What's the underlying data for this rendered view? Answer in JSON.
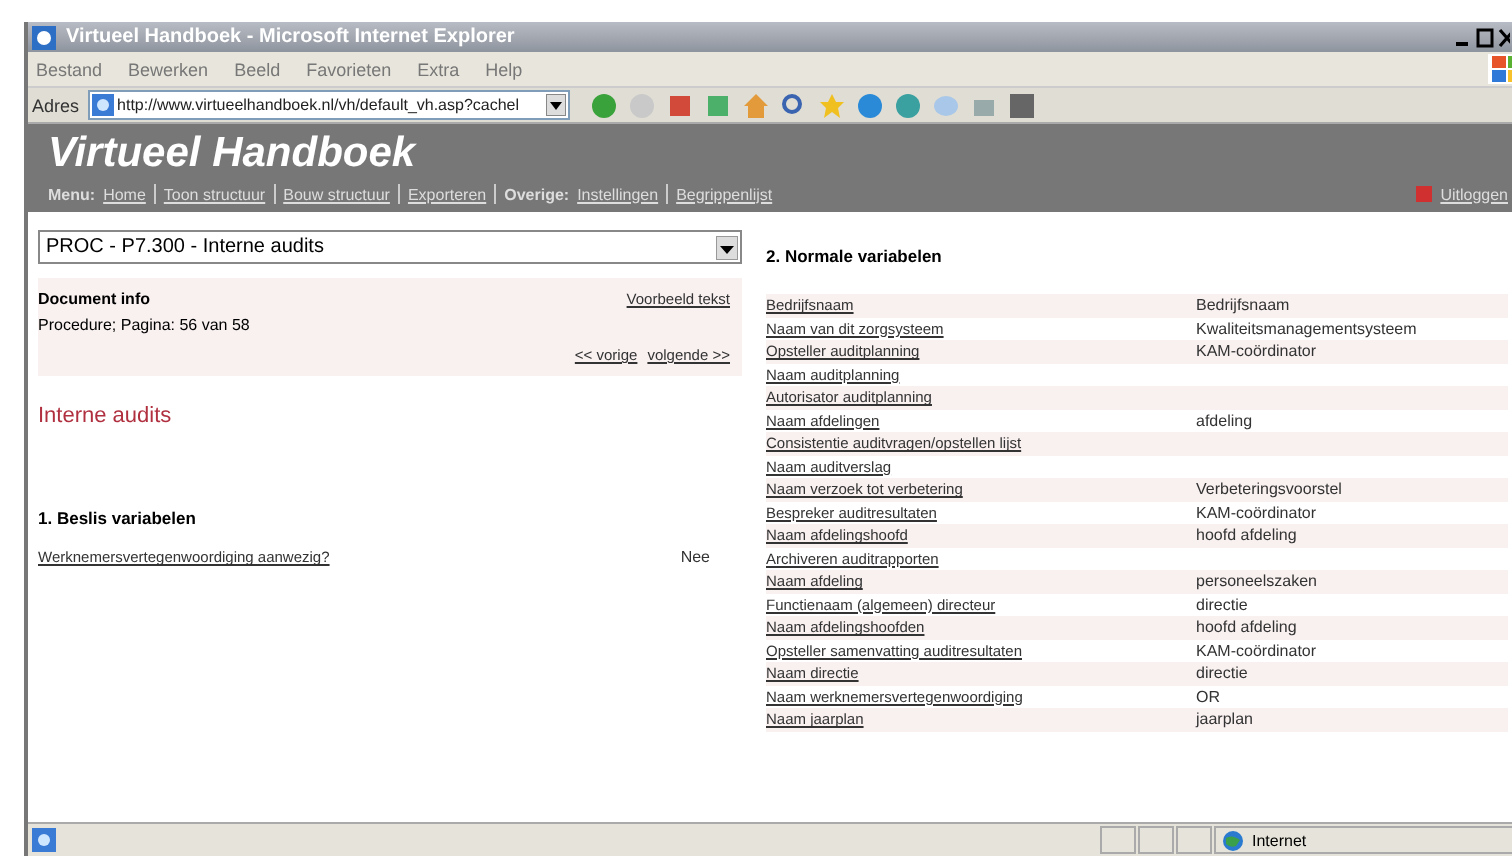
{
  "window": {
    "title": "Virtueel Handboek - Microsoft Internet Explorer"
  },
  "menu_bar": [
    "Bestand",
    "Bewerken",
    "Beeld",
    "Favorieten",
    "Extra",
    "Help"
  ],
  "address_bar": {
    "label": "Adres",
    "value": "http://www.virtueelhandboek.nl/vh/default_vh.asp?cachel"
  },
  "banner": {
    "title": "Virtueel Handboek",
    "nav_groups": [
      {
        "label": "Menu:",
        "links": [
          "Home",
          "Toon structuur",
          "Bouw structuur",
          "Exporteren"
        ]
      },
      {
        "label": "Overige:",
        "links": [
          "Instellingen",
          "Begrippenlijst"
        ]
      }
    ],
    "logout": "Uitloggen"
  },
  "document_select": {
    "value": "PROC - P7.300 - Interne audits"
  },
  "document_info": {
    "title": "Document info",
    "example_link": "Voorbeeld tekst",
    "meta": "Procedure; Pagina: 56 van 58",
    "prev": "<< vorige",
    "next": "volgende >>"
  },
  "page_title": "Interne audits",
  "section_1": {
    "title": "1. Beslis variabelen",
    "rows": [
      {
        "name": "Werknemersvertegenwoordiging aanwezig?",
        "value": "Nee"
      }
    ]
  },
  "section_2": {
    "title": "2. Normale variabelen",
    "rows": [
      {
        "name": "Bedrijfsnaam",
        "value": "Bedrijfsnaam"
      },
      {
        "name": "Naam van dit zorgsysteem",
        "value": "Kwaliteitsmanagementsysteem"
      },
      {
        "name": "Opsteller auditplanning",
        "value": "KAM-coördinator"
      },
      {
        "name": "Naam auditplanning"
      },
      {
        "name": "Autorisator auditplanning"
      },
      {
        "name": "Naam afdelingen",
        "value": "afdeling"
      },
      {
        "name": "Consistentie auditvragen/opstellen lijst"
      },
      {
        "name": "Naam auditverslag"
      },
      {
        "name": "Naam verzoek tot verbetering",
        "value": "Verbeteringsvoorstel"
      },
      {
        "name": "Bespreker auditresultaten",
        "value": "KAM-coördinator"
      },
      {
        "name": "Naam afdelingshoofd",
        "value": "hoofd afdeling"
      },
      {
        "name": "Archiveren auditrapporten"
      },
      {
        "name": "Naam afdeling",
        "value": "personeelszaken"
      },
      {
        "name": "Functienaam (algemeen) directeur",
        "value": "directie"
      },
      {
        "name": "Naam afdelingshoofden",
        "value": "hoofd afdeling"
      },
      {
        "name": "Opsteller samenvatting auditresultaten",
        "value": "KAM-coördinator"
      },
      {
        "name": "Naam directie",
        "value": "directie"
      },
      {
        "name": "Naam werknemersvertegenwoordiging",
        "value": "OR"
      },
      {
        "name": "Naam jaarplan",
        "value": "jaarplan"
      }
    ]
  },
  "status_bar": {
    "zone": "Internet"
  }
}
